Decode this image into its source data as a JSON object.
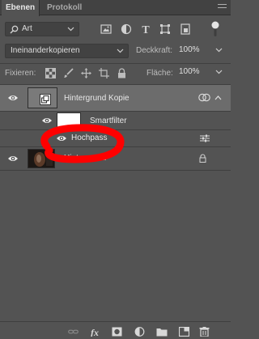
{
  "tabs": [
    {
      "label": "Ebenen",
      "active": true
    },
    {
      "label": "Protokoll",
      "active": false
    }
  ],
  "filter": {
    "kind_value": "Art",
    "icons": [
      "image-filter-icon",
      "adjustment-filter-icon",
      "type-filter-icon",
      "shape-filter-icon",
      "smart-object-filter-icon"
    ]
  },
  "blend": {
    "mode_value": "Ineinanderkopieren",
    "opacity_label": "Deckkraft:",
    "opacity_value": "100%"
  },
  "lock": {
    "label": "Fixieren:",
    "fill_label": "Fläche:",
    "fill_value": "100%"
  },
  "layers": [
    {
      "name": "Hintergrund Kopie",
      "type": "smart-object",
      "selected": true,
      "visible": true
    },
    {
      "name": "Smartfilter",
      "type": "smart-filter-mask",
      "visible": true
    },
    {
      "name": "Hochpass",
      "type": "filter",
      "visible": true
    },
    {
      "name": "Hintergrund",
      "type": "background",
      "visible": true,
      "locked": true
    }
  ],
  "bottom_icons": [
    "link-layers-icon",
    "fx-icon",
    "layer-mask-icon",
    "adjustment-layer-icon",
    "group-folder-icon",
    "new-layer-icon",
    "trash-icon"
  ],
  "colors": {
    "panel": "#535353",
    "selected_row": "#6c6c6c",
    "annotation": "#ff0000"
  }
}
